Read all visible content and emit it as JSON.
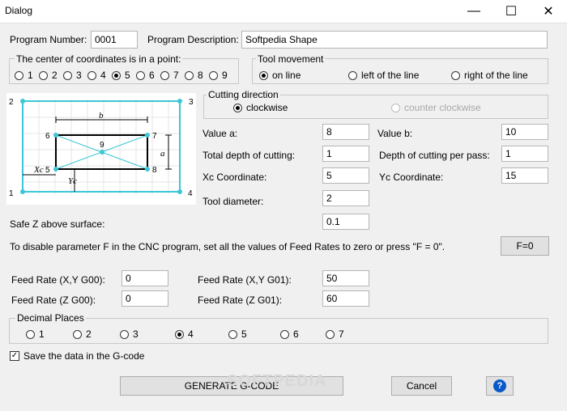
{
  "window": {
    "title": "Dialog",
    "minimize": "—",
    "maximize": "☐",
    "close": "✕"
  },
  "program": {
    "number_label": "Program Number:",
    "number_value": "0001",
    "description_label": "Program Description:",
    "description_value": "Softpedia Shape"
  },
  "center": {
    "title": "The center of coordinates is in a point:",
    "options": [
      "1",
      "2",
      "3",
      "4",
      "5",
      "6",
      "7",
      "8",
      "9"
    ],
    "selected": "5"
  },
  "movement": {
    "title": "Tool movement",
    "options": [
      "on line",
      "left of the line",
      "right of the line"
    ],
    "selected": "on line"
  },
  "direction": {
    "title": "Cutting direction",
    "clockwise": "clockwise",
    "counter": "counter clockwise",
    "selected": "clockwise"
  },
  "diagram": {
    "labels": {
      "p1": "1",
      "p2": "2",
      "p3": "3",
      "p4": "4",
      "p5": "5",
      "p6": "6",
      "p7": "7",
      "p8": "8",
      "p9": "9"
    },
    "dim_b": "b",
    "dim_a": "a",
    "dim_xc": "Xc",
    "dim_yc": "Yc"
  },
  "params": {
    "value_a_label": "Value a:",
    "value_a": "8",
    "value_b_label": "Value b:",
    "value_b": "10",
    "total_depth_label": "Total depth of cutting:",
    "total_depth": "1",
    "depth_pass_label": "Depth of cutting per pass:",
    "depth_pass": "1",
    "xc_label": "Xc Coordinate:",
    "xc": "5",
    "yc_label": "Yc Coordinate:",
    "yc": "15",
    "tool_diameter_label": "Tool diameter:",
    "tool_diameter": "2",
    "safe_z_label": "Safe Z above surface:",
    "safe_z": "0.1"
  },
  "feed": {
    "note": "To disable parameter F in the CNC program, set all the values of Feed Rates to zero or press \"F = 0\".",
    "f0_button": "F=0",
    "xy_g00_label": "Feed Rate (X,Y G00):",
    "xy_g00": "0",
    "z_g00_label": "Feed Rate (Z G00):",
    "z_g00": "0",
    "xy_g01_label": "Feed Rate (X,Y G01):",
    "xy_g01": "50",
    "z_g01_label": "Feed Rate (Z G01):",
    "z_g01": "60"
  },
  "decimal": {
    "title": "Decimal Places",
    "options": [
      "1",
      "2",
      "3",
      "4",
      "5",
      "6",
      "7"
    ],
    "selected": "4"
  },
  "save_gcode": {
    "label": "Save the data in the G-code",
    "checked": true,
    "mark": "✓"
  },
  "buttons": {
    "generate": "GENERATE G-CODE",
    "cancel": "Cancel",
    "help": "?"
  },
  "watermark": "SOFTPEDIA",
  "colors": {
    "shape_line": "#3cc6d6",
    "accent": "#0a58c8"
  }
}
